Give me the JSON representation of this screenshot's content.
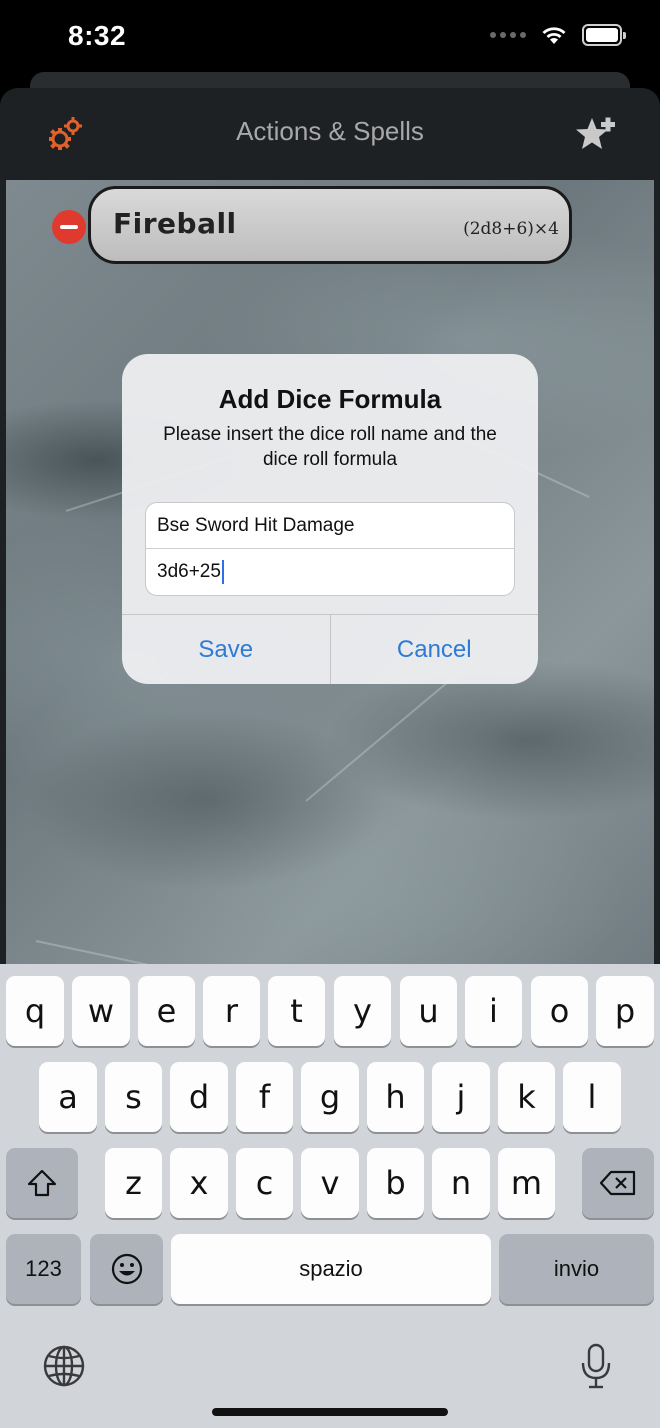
{
  "status_bar": {
    "time": "8:32"
  },
  "nav": {
    "title": "Actions & Spells",
    "settings_icon": "gears-icon",
    "add_icon": "star-plus-icon",
    "accent_color": "#e0612a"
  },
  "spells": [
    {
      "name": "Fireball",
      "formula": "(2d8+6)×4"
    }
  ],
  "alert": {
    "title": "Add Dice Formula",
    "message": "Please insert the dice roll name and the dice roll formula",
    "name_value": "Bse Sword Hit Damage",
    "formula_value": "3d6+25",
    "save_label": "Save",
    "cancel_label": "Cancel",
    "button_color": "#2e7ad6"
  },
  "keyboard": {
    "row1": [
      "q",
      "w",
      "e",
      "r",
      "t",
      "y",
      "u",
      "i",
      "o",
      "p"
    ],
    "row2": [
      "a",
      "s",
      "d",
      "f",
      "g",
      "h",
      "j",
      "k",
      "l"
    ],
    "row3": [
      "z",
      "x",
      "c",
      "v",
      "b",
      "n",
      "m"
    ],
    "numbers_label": "123",
    "space_label": "spazio",
    "return_label": "invio"
  }
}
